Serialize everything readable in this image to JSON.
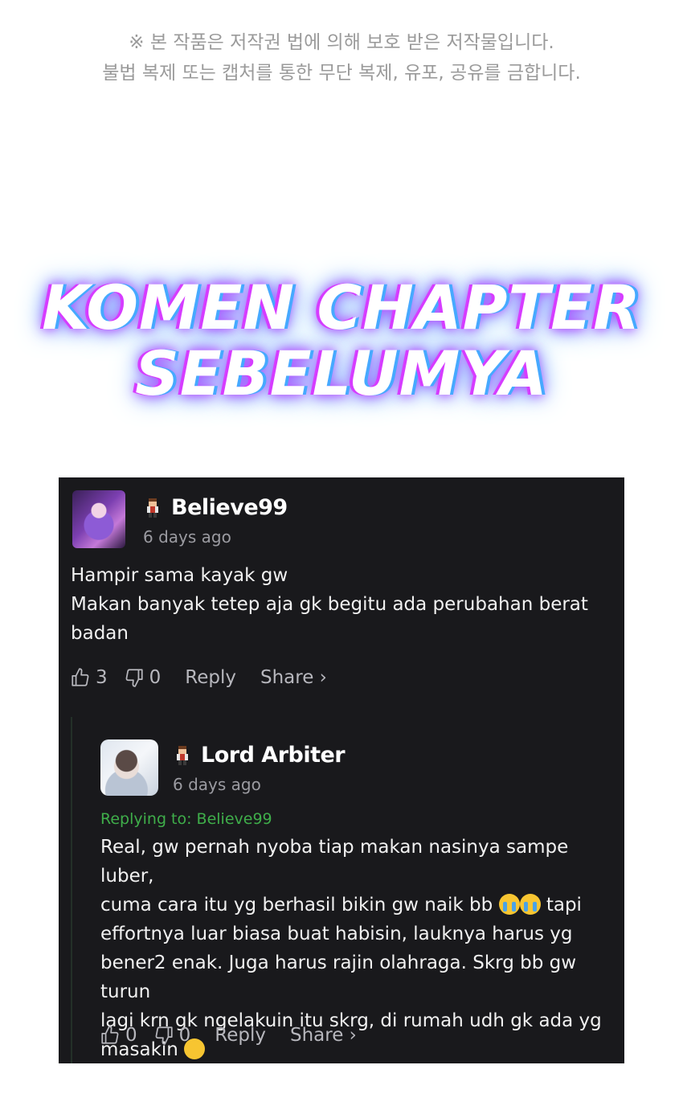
{
  "notice": {
    "line1": "※ 본 작품은 저작권 법에 의해 보호 받은 저작물입니다.",
    "line2": "불법 복제 또는 캡처를 통한 무단 복제, 유포, 공유를 금합니다."
  },
  "banner": {
    "line1": "KOMEN CHAPTER",
    "line2": "SEBELUMYA"
  },
  "comments": [
    {
      "username": "Believe99",
      "time": "6 days ago",
      "text": "Hampir sama kayak gw\nMakan banyak tetep aja gk begitu ada perubahan berat\nbadan",
      "likes": "3",
      "dislikes": "0",
      "reply_label": "Reply",
      "share_label": "Share ›"
    },
    {
      "username": "Lord Arbiter",
      "time": "6 days ago",
      "replying_to": "Replying to: Believe99",
      "text_part1": "Real, gw pernah nyoba tiap makan nasinya sampe luber,\ncuma cara itu yg berhasil bikin gw naik bb",
      "text_part2": "tapi\neffortnya luar biasa buat habisin, lauknya harus yg\nbener2 enak. Juga harus rajin olahraga. Skrg bb gw turun\nlagi krn gk ngelakuin itu skrg, di rumah udh gk ada yg\nmasakin",
      "likes": "0",
      "dislikes": "0",
      "reply_label": "Reply",
      "share_label": "Share ›"
    }
  ],
  "colors": {
    "card_bg": "#19191c",
    "reply_green": "#3fae4a",
    "muted": "#9b9ba1"
  },
  "icons": [
    "thumbs-up-icon",
    "thumbs-down-icon",
    "pixel-avatar-icon",
    "crying-face-emoji",
    "confounded-face-emoji"
  ]
}
